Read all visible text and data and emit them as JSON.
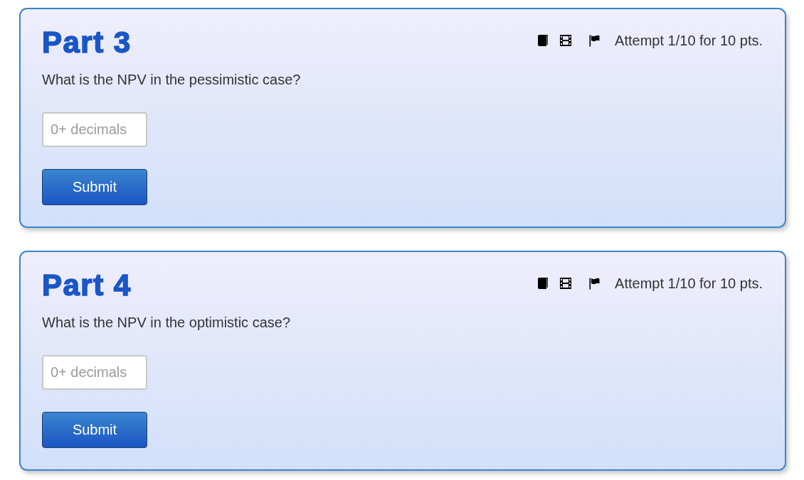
{
  "parts": [
    {
      "title": "Part 3",
      "attempt": "Attempt 1/10 for 10 pts.",
      "question": "What is the NPV in the pessimistic case?",
      "answer": {
        "placeholder": "0+ decimals"
      },
      "submit": "Submit"
    },
    {
      "title": "Part 4",
      "attempt": "Attempt 1/10 for 10 pts.",
      "question": "What is the NPV in the optimistic case?",
      "answer": {
        "placeholder": "0+ decimals"
      },
      "submit": "Submit"
    }
  ]
}
